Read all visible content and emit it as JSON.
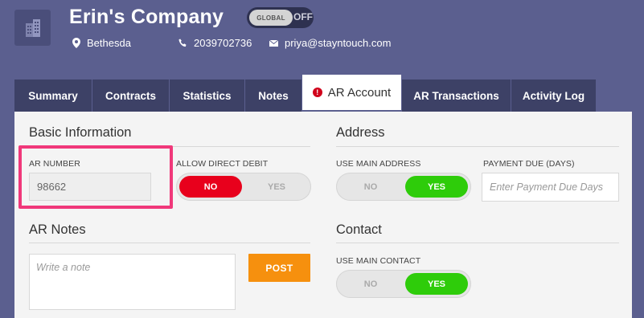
{
  "header": {
    "company_name": "Erin's Company",
    "global_toggle": {
      "label": "GLOBAL",
      "state": "OFF"
    },
    "location": "Bethesda",
    "phone": "2039702736",
    "email": "priya@stayntouch.com"
  },
  "tabs": [
    {
      "label": "Summary"
    },
    {
      "label": "Contracts"
    },
    {
      "label": "Statistics"
    },
    {
      "label": "Notes"
    },
    {
      "label": "AR Account",
      "active": true,
      "alert": "!"
    },
    {
      "label": "AR Transactions"
    },
    {
      "label": "Activity Log"
    }
  ],
  "basic_info": {
    "title": "Basic Information",
    "ar_number_label": "AR NUMBER",
    "ar_number_value": "98662",
    "direct_debit_label": "ALLOW DIRECT DEBIT",
    "direct_debit_no": "NO",
    "direct_debit_yes": "YES",
    "direct_debit_selected": "NO"
  },
  "address": {
    "title": "Address",
    "use_main_label": "USE MAIN ADDRESS",
    "use_main_no": "NO",
    "use_main_yes": "YES",
    "use_main_selected": "YES",
    "payment_due_label": "PAYMENT DUE (DAYS)",
    "payment_due_placeholder": "Enter Payment Due Days"
  },
  "ar_notes": {
    "title": "AR Notes",
    "placeholder": "Write a note",
    "post_label": "POST"
  },
  "contact": {
    "title": "Contact",
    "use_main_label": "USE MAIN CONTACT",
    "use_main_no": "NO",
    "use_main_yes": "YES",
    "use_main_selected": "YES"
  },
  "colors": {
    "background": "#5b5f8f",
    "tab_bar": "#3d4166",
    "highlight": "#f0387a",
    "toggle_red": "#e8001c",
    "toggle_green": "#2ecc0a",
    "post_button": "#f6900e"
  }
}
